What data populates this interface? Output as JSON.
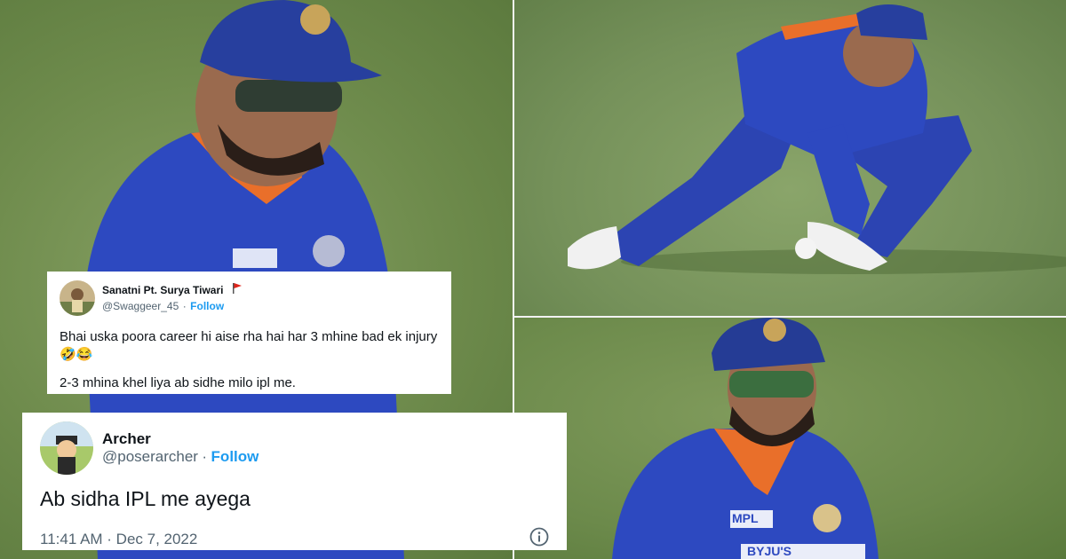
{
  "tweet1": {
    "name": "Sanatni Pt. Surya Tiwari",
    "handle": "@Swaggeer_45",
    "separator": "·",
    "follow": "Follow",
    "line1": "Bhai uska poora career hi aise rha hai har 3 mhine bad ek injury 🤣😂",
    "line2": "2-3 mhina khel liya ab sidhe milo ipl me."
  },
  "tweet2": {
    "name": "Archer",
    "handle": "@poserarcher",
    "separator": "·",
    "follow": "Follow",
    "text": "Ab sidha IPL me ayega",
    "timestamp": "11:41 AM · Dec 7, 2022"
  },
  "jersey": {
    "sponsor_left": "MPL",
    "sponsor_right": "BYJU'S"
  },
  "colors": {
    "follow_blue": "#1d9bf0",
    "jersey_blue": "#2a45b8",
    "cap_navy": "#253c95",
    "collar_orange": "#e96f2a"
  }
}
